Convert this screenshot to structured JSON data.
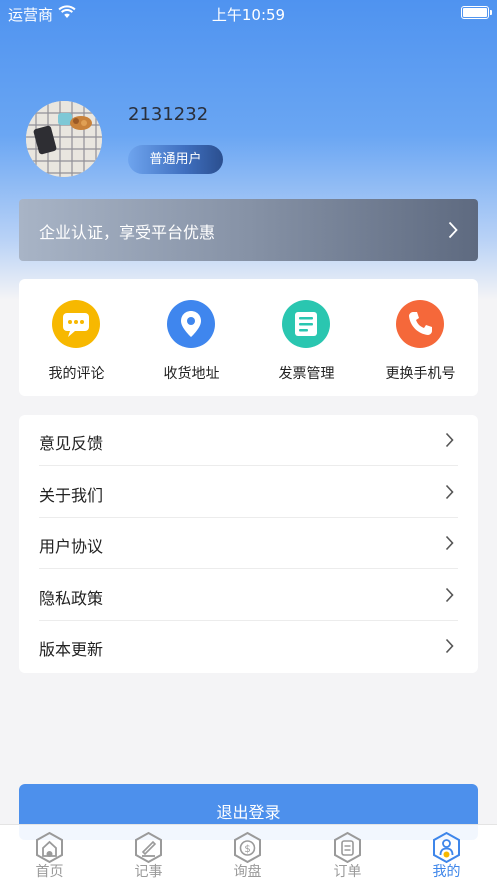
{
  "status_bar": {
    "carrier": "运营商",
    "time": "上午10:59",
    "wifi_icon": "wifi-icon",
    "battery_icon": "battery-icon"
  },
  "profile": {
    "username": "2131232",
    "user_type": "普通用户",
    "avatar_icon": "avatar-photo"
  },
  "cert_banner": {
    "label": "企业认证，享受平台优惠"
  },
  "quick_actions": [
    {
      "label": "我的评论",
      "icon": "comment-icon",
      "color": "#f7b800"
    },
    {
      "label": "收货地址",
      "icon": "location-pin-icon",
      "color": "#3f86ee"
    },
    {
      "label": "发票管理",
      "icon": "invoice-icon",
      "color": "#2ac6b0"
    },
    {
      "label": "更换手机号",
      "icon": "phone-icon",
      "color": "#f5683a"
    }
  ],
  "menu": [
    {
      "label": "意见反馈"
    },
    {
      "label": "关于我们"
    },
    {
      "label": "用户协议"
    },
    {
      "label": "隐私政策"
    },
    {
      "label": "版本更新"
    }
  ],
  "logout_label": "退出登录",
  "tabs": [
    {
      "label": "首页",
      "icon": "home-icon",
      "active": false
    },
    {
      "label": "记事",
      "icon": "notes-icon",
      "active": false
    },
    {
      "label": "询盘",
      "icon": "inquiry-icon",
      "active": false
    },
    {
      "label": "订单",
      "icon": "order-icon",
      "active": false
    },
    {
      "label": "我的",
      "icon": "profile-icon",
      "active": true
    }
  ],
  "colors": {
    "accent": "#4d90ec",
    "tab_active": "#3e86ea",
    "tab_inactive": "#9a9a9a"
  }
}
